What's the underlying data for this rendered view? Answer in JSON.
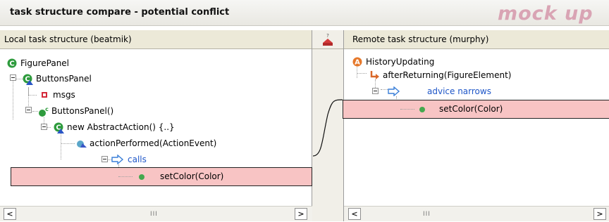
{
  "window": {
    "title": "task structure compare - potential conflict",
    "watermark": "mock up"
  },
  "left_pane": {
    "header": "Local task structure (beatmik)",
    "nodes": [
      {
        "label": "FigurePanel",
        "icon": "class-icon"
      },
      {
        "label": "ButtonsPanel",
        "icon": "inner-class-icon"
      },
      {
        "label": "msgs",
        "icon": "private-field-icon"
      },
      {
        "label": "ButtonsPanel()",
        "icon": "constructor-icon"
      },
      {
        "label": "new AbstractAction() {..}",
        "icon": "anonymous-class-icon"
      },
      {
        "label": "actionPerformed(ActionEvent)",
        "icon": "method-icon"
      },
      {
        "label": "calls",
        "icon": "arrow-right-icon"
      },
      {
        "label": "setColor(Color)",
        "icon": "public-method-icon"
      }
    ]
  },
  "right_pane": {
    "header": "Remote task structure (murphy)",
    "nodes": [
      {
        "label": "HistoryUpdating",
        "icon": "aspect-icon"
      },
      {
        "label": "afterReturning(FigureElement)",
        "icon": "advice-icon"
      },
      {
        "label": "advice narrows",
        "icon": "arrow-right-icon"
      },
      {
        "label": "setColor(Color)",
        "icon": "public-method-icon"
      }
    ]
  },
  "scrollbar": {
    "left_arrow": "<",
    "right_arrow": ">",
    "grip": "III"
  },
  "colors": {
    "highlight": "#f8c4c4",
    "link": "#1e56c8",
    "watermark": "#d9a4b4"
  }
}
